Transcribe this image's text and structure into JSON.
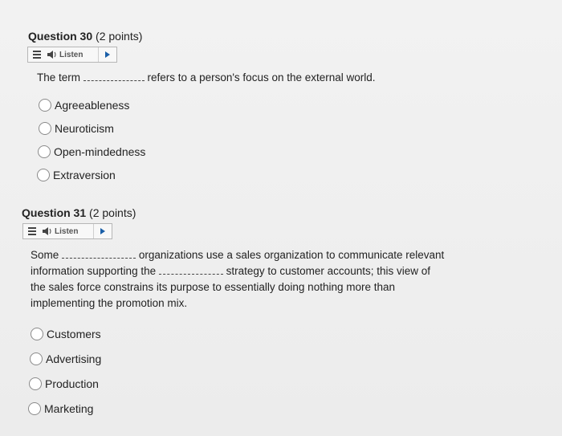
{
  "questions": [
    {
      "title": "Question 30",
      "points": "(2 points)",
      "listen_label": "Listen",
      "stem_part1": "The term",
      "stem_part2": "refers to a person's focus on the external world.",
      "options": [
        "Agreeableness",
        "Neuroticism",
        "Open-mindedness",
        "Extraversion"
      ]
    },
    {
      "title": "Question 31",
      "points": "(2 points)",
      "listen_label": "Listen",
      "stem_line1_a": "Some",
      "stem_line1_b": "organizations use a sales organization to communicate relevant",
      "stem_line2_a": "information supporting the",
      "stem_line2_b": "strategy to customer accounts; this view of",
      "stem_line3": "the sales force constrains its purpose to essentially doing nothing more than",
      "stem_line4": "implementing the promotion mix.",
      "options": [
        "Customers",
        "Advertising",
        "Production",
        "Marketing"
      ]
    }
  ],
  "icons": {
    "menu": "menu-icon",
    "speaker": "speaker-icon",
    "play": "play-icon"
  },
  "colors": {
    "play_accent": "#1a5fa8"
  }
}
